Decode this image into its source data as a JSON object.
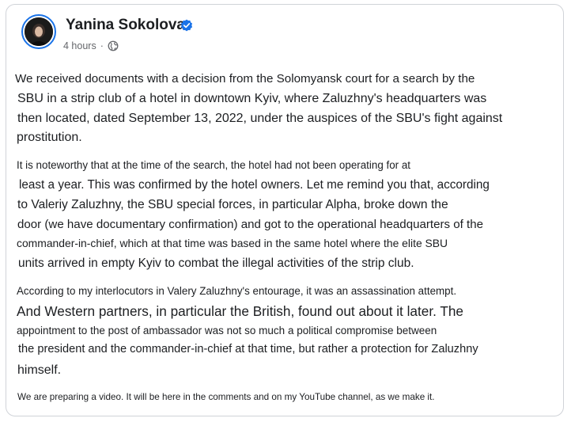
{
  "post": {
    "author": "Yanina Sokolova",
    "timestamp": "4 hours",
    "separator": "·",
    "icons": {
      "verified": "verified-badge-icon",
      "privacy": "globe-icon"
    },
    "accent_color": "#1a73e8",
    "lines": [
      "We received documents with a decision from the Solomyansk court for a search by the",
      "SBU in a strip club of a hotel in downtown Kyiv, where Zaluzhny's headquarters was",
      "then located, dated September 13, 2022, under the auspices of the SBU's fight against",
      "prostitution.",
      "It is noteworthy that at the time of the search, the hotel had not been operating for at",
      "least a year. This was confirmed by the hotel owners. Let me remind you that, according",
      "to Valeriy Zaluzhny, the SBU special forces, in particular Alpha, broke down the",
      "door (we have documentary confirmation) and got to the operational headquarters of the",
      "commander-in-chief, which at that time was based in the same hotel where the elite SBU",
      "units arrived in empty Kyiv to combat the illegal activities of the strip club.",
      "According to my interlocutors in Valery Zaluzhny's entourage, it was an assassination attempt.",
      "And Western partners, in particular the British, found out about it later. The",
      "appointment to the post of ambassador was not so much a political compromise between",
      "the president and the commander-in-chief at that time, but rather a protection for Zaluzhny",
      "himself.",
      "We are preparing a video. It will be here in the comments and on my YouTube channel, as we make it."
    ]
  }
}
